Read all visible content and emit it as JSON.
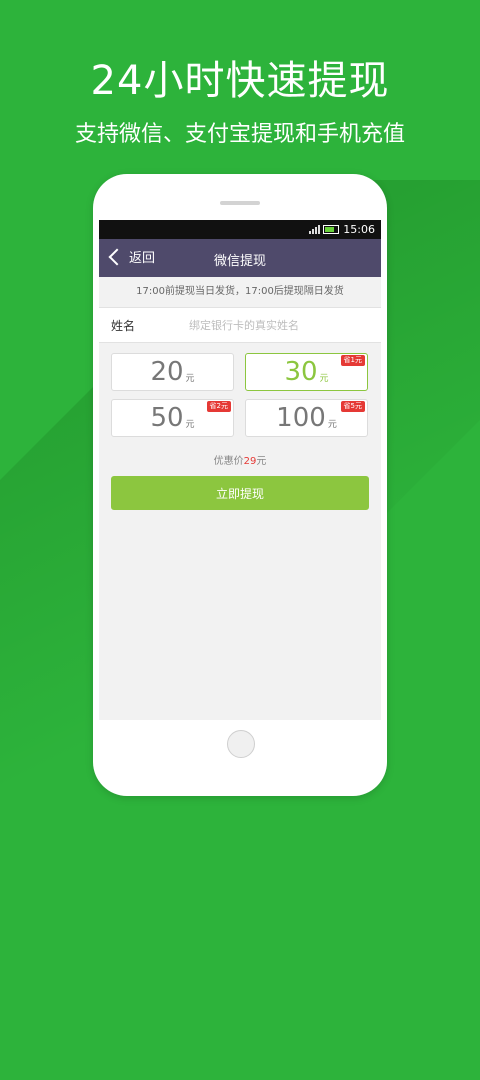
{
  "promo": {
    "headline": "24小时快速提现",
    "subline": "支持微信、支付宝提现和手机充值"
  },
  "status_bar": {
    "time": "15:06"
  },
  "nav": {
    "back_label": "返回",
    "title": "微信提现"
  },
  "notice": "17:00前提现当日发货，17:00后提现隔日发货",
  "form": {
    "name_label": "姓名",
    "name_placeholder": "绑定银行卡的真实姓名"
  },
  "amounts": [
    {
      "amount": "20",
      "unit": "元",
      "badge": "",
      "selected": false
    },
    {
      "amount": "30",
      "unit": "元",
      "badge": "省1元",
      "selected": true
    },
    {
      "amount": "50",
      "unit": "元",
      "badge": "省2元",
      "selected": false
    },
    {
      "amount": "100",
      "unit": "元",
      "badge": "省5元",
      "selected": false
    }
  ],
  "discount": {
    "label": "优惠价",
    "price": "29",
    "unit": "元"
  },
  "submit_label": "立即提现",
  "colors": {
    "background": "#2db33b",
    "nav": "#4f4a6b",
    "accent": "#8cc63f",
    "badge": "#e53935"
  }
}
